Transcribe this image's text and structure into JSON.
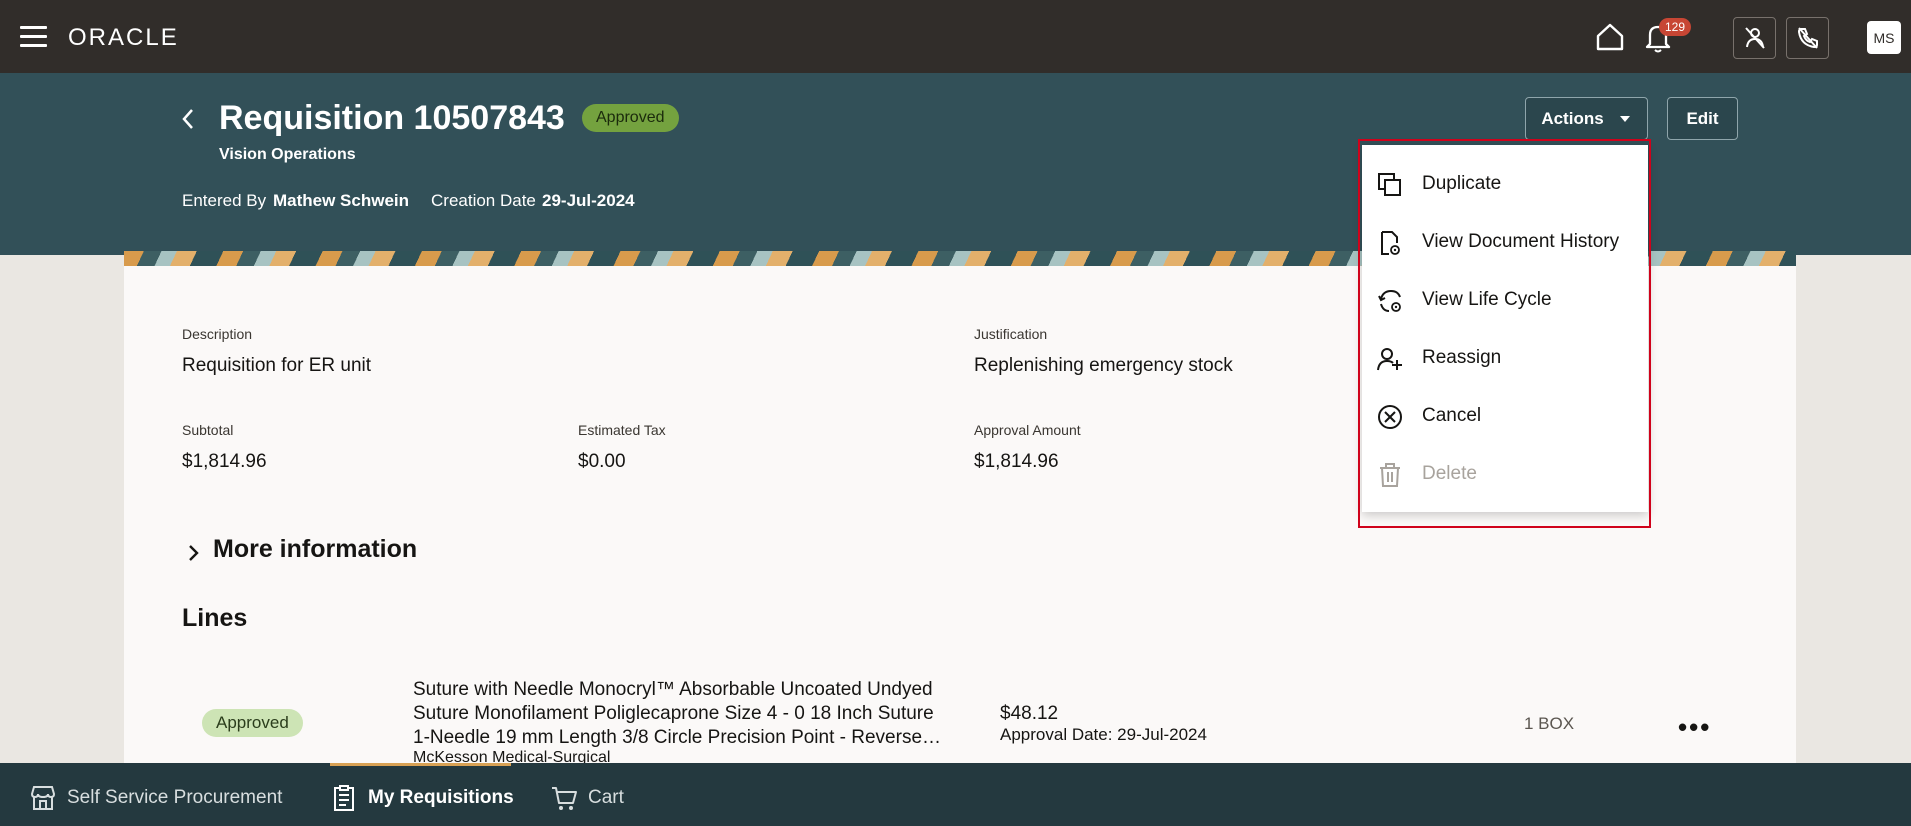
{
  "topbar": {
    "logo": "ORACLE",
    "notifications_count": "129",
    "avatar_initials": "MS"
  },
  "header": {
    "title": "Requisition 10507843",
    "status": "Approved",
    "business_unit": "Vision Operations",
    "entered_by_label": "Entered By",
    "entered_by": "Mathew Schwein",
    "creation_date_label": "Creation Date",
    "creation_date": "29-Jul-2024",
    "actions_label": "Actions",
    "edit_label": "Edit"
  },
  "details": {
    "description_label": "Description",
    "description": "Requisition for ER unit",
    "justification_label": "Justification",
    "justification": "Replenishing emergency stock",
    "subtotal_label": "Subtotal",
    "subtotal": "$1,814.96",
    "tax_label": "Estimated Tax",
    "tax": "$0.00",
    "approval_amount_label": "Approval Amount",
    "approval_amount": "$1,814.96",
    "more_info": "More information"
  },
  "lines": {
    "title": "Lines",
    "row": {
      "status": "Approved",
      "desc_line1": "Suture with Needle Monocryl™ Absorbable Uncoated Undyed",
      "desc_line2": "Suture Monofilament Poliglecaprone Size 4 - 0 18 Inch Suture",
      "desc_line3": "1-Needle 19 mm Length 3/8 Circle Precision Point - Reverse…",
      "supplier": "McKesson Medical-Surgical",
      "price": "$48.12",
      "approval_date": "Approval Date: 29-Jul-2024",
      "quantity": "1 BOX",
      "more": "•••"
    }
  },
  "actions_menu": {
    "items": [
      {
        "label": "Duplicate",
        "icon": "duplicate-icon",
        "enabled": true
      },
      {
        "label": "View Document History",
        "icon": "document-history-icon",
        "enabled": true
      },
      {
        "label": "View Life Cycle",
        "icon": "life-cycle-icon",
        "enabled": true
      },
      {
        "label": "Reassign",
        "icon": "reassign-icon",
        "enabled": true
      },
      {
        "label": "Cancel",
        "icon": "cancel-icon",
        "enabled": true
      },
      {
        "label": "Delete",
        "icon": "trash-icon",
        "enabled": false
      }
    ]
  },
  "bottom_nav": {
    "items": [
      {
        "label": "Self Service Procurement"
      },
      {
        "label": "My Requisitions"
      },
      {
        "label": "Cart"
      }
    ],
    "active": "My Requisitions"
  },
  "colors": {
    "topbar": "#312d2a",
    "header": "#325058",
    "approved_badge": "#74a23f",
    "menu_highlight_border": "#d0021b",
    "bottom_nav": "#24393f",
    "active_tab_accent": "#d8a154"
  }
}
